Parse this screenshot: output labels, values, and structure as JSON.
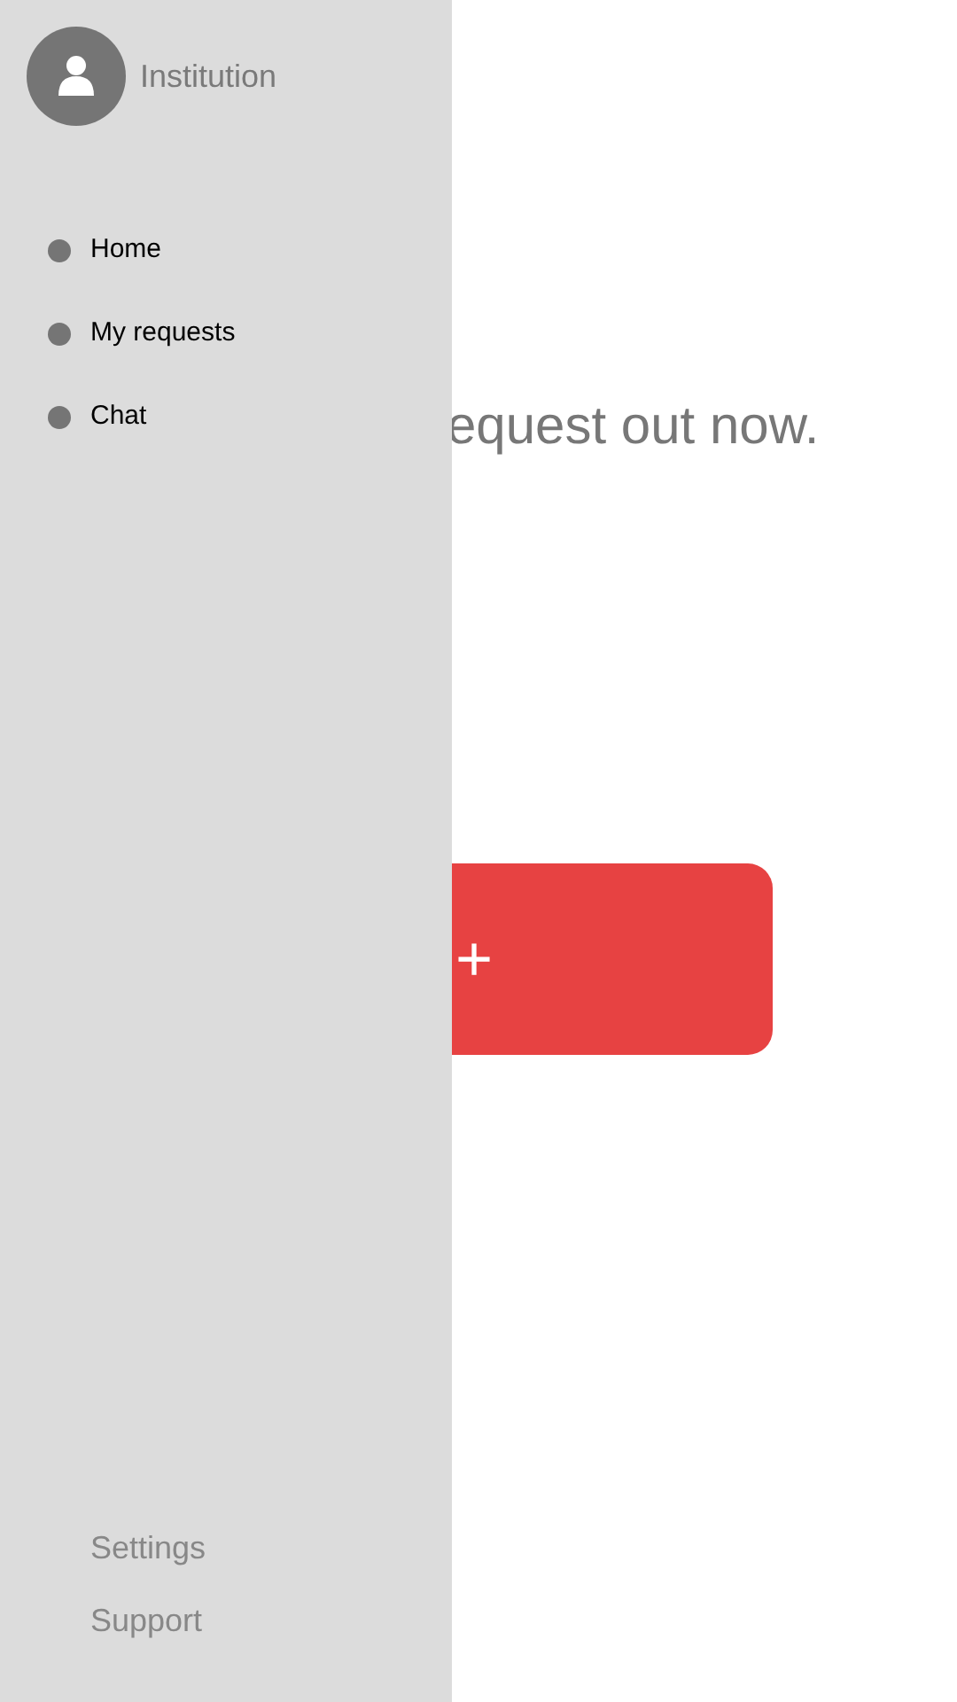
{
  "drawer": {
    "profile": {
      "name": "Institution"
    },
    "nav_items": [
      {
        "label": "Home"
      },
      {
        "label": "My requests"
      },
      {
        "label": "Chat"
      }
    ],
    "footer_links": [
      "Settings",
      "Support"
    ]
  },
  "main": {
    "headline": "equest out now.",
    "add_button": {
      "label": "+"
    }
  }
}
